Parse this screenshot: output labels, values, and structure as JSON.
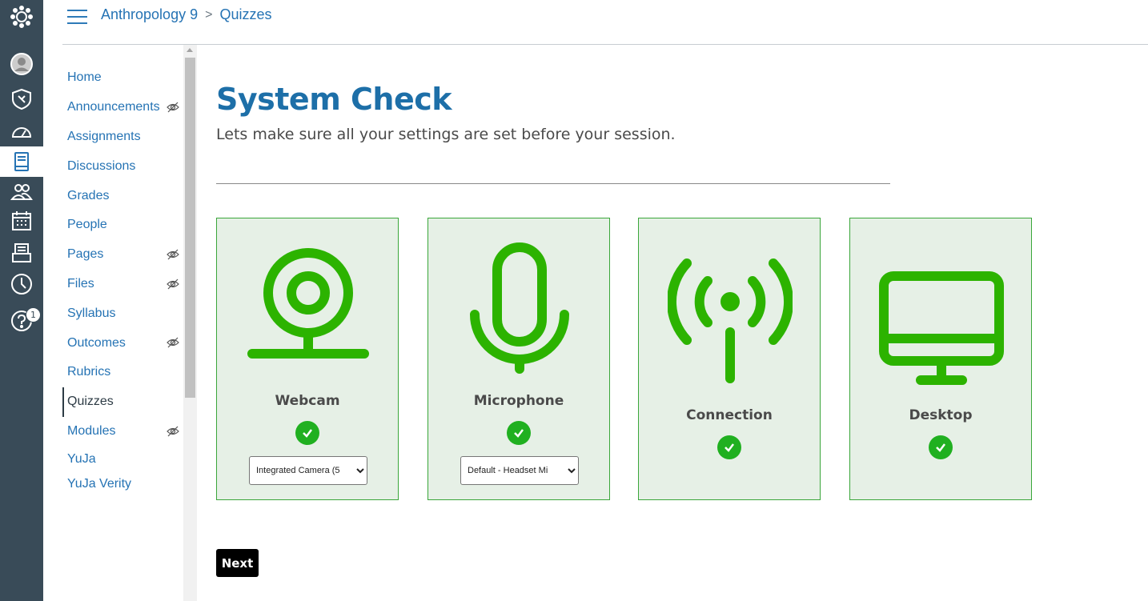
{
  "breadcrumb": {
    "course": "Anthropology 9",
    "separator": ">",
    "current": "Quizzes"
  },
  "global_nav": {
    "items": [
      "logo-icon",
      "account-icon",
      "admin-icon",
      "dashboard-icon",
      "courses-icon",
      "groups-icon",
      "calendar-icon",
      "inbox-icon",
      "history-icon",
      "help-icon"
    ],
    "help_badge": "1"
  },
  "course_nav": {
    "items": [
      {
        "label": "Home",
        "hidden": false
      },
      {
        "label": "Announcements",
        "hidden": true
      },
      {
        "label": "Assignments",
        "hidden": false
      },
      {
        "label": "Discussions",
        "hidden": false
      },
      {
        "label": "Grades",
        "hidden": false
      },
      {
        "label": "People",
        "hidden": false
      },
      {
        "label": "Pages",
        "hidden": true
      },
      {
        "label": "Files",
        "hidden": true
      },
      {
        "label": "Syllabus",
        "hidden": false
      },
      {
        "label": "Outcomes",
        "hidden": true
      },
      {
        "label": "Rubrics",
        "hidden": false
      },
      {
        "label": "Quizzes",
        "hidden": false,
        "active": true
      },
      {
        "label": "Modules",
        "hidden": true
      },
      {
        "label": "YuJa",
        "hidden": false
      },
      {
        "label": "YuJa Verity",
        "hidden": false
      }
    ]
  },
  "main": {
    "title": "System Check",
    "subtitle": "Lets make sure all your settings are set before your session.",
    "cards": [
      {
        "label": "Webcam",
        "icon": "webcam-icon",
        "status": "ok",
        "select_value": "Integrated Camera (5"
      },
      {
        "label": "Microphone",
        "icon": "microphone-icon",
        "status": "ok",
        "select_value": "Default - Headset Mi"
      },
      {
        "label": "Connection",
        "icon": "connection-icon",
        "status": "ok"
      },
      {
        "label": "Desktop",
        "icon": "desktop-icon",
        "status": "ok"
      }
    ],
    "next_label": "Next"
  },
  "colors": {
    "nav_bg": "#394b58",
    "link": "#2573b4",
    "title": "#1d6fa8",
    "card_bg": "#e6f0e6",
    "success": "#20b020"
  }
}
